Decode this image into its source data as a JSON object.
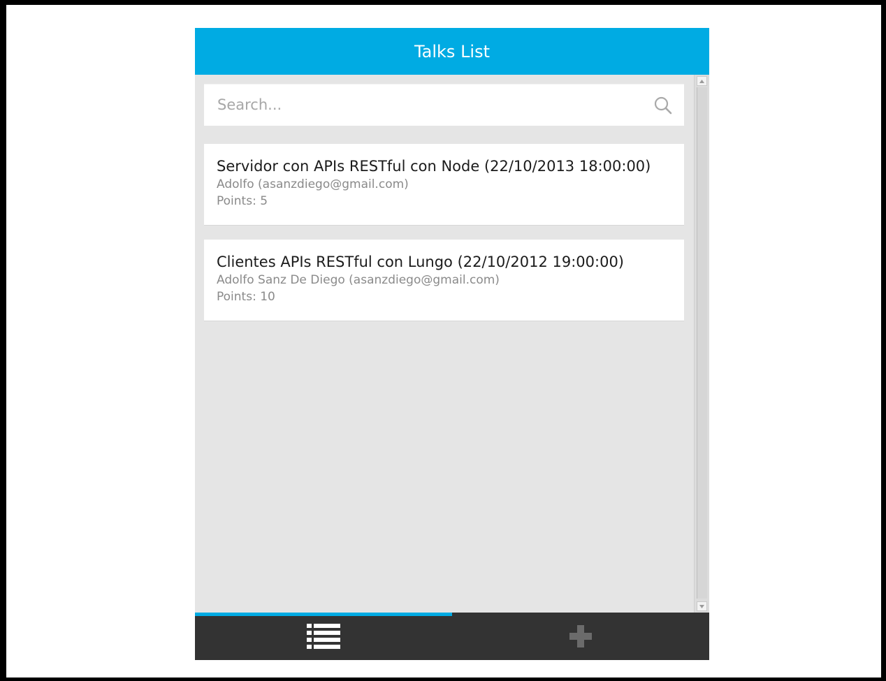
{
  "header": {
    "title": "Talks List"
  },
  "search": {
    "placeholder": "Search...",
    "icon": "search-icon"
  },
  "talks": [
    {
      "title": "Servidor con APIs RESTful con Node (22/10/2013 18:00:00)",
      "author": "Adolfo (asanzdiego@gmail.com)",
      "points": "Points: 5"
    },
    {
      "title": "Clientes APIs RESTful con Lungo (22/10/2012 19:00:00)",
      "author": "Adolfo Sanz De Diego (asanzdiego@gmail.com)",
      "points": "Points: 10"
    }
  ],
  "tabbar": {
    "tabs": [
      {
        "icon": "list-icon",
        "active": true
      },
      {
        "icon": "plus-icon",
        "active": false
      }
    ]
  },
  "colors": {
    "accent": "#00abe3",
    "tabbar_bg": "#333333",
    "content_bg": "#e5e5e5",
    "active_icon": "#ffffff",
    "inactive_icon": "#6b6b6b"
  }
}
